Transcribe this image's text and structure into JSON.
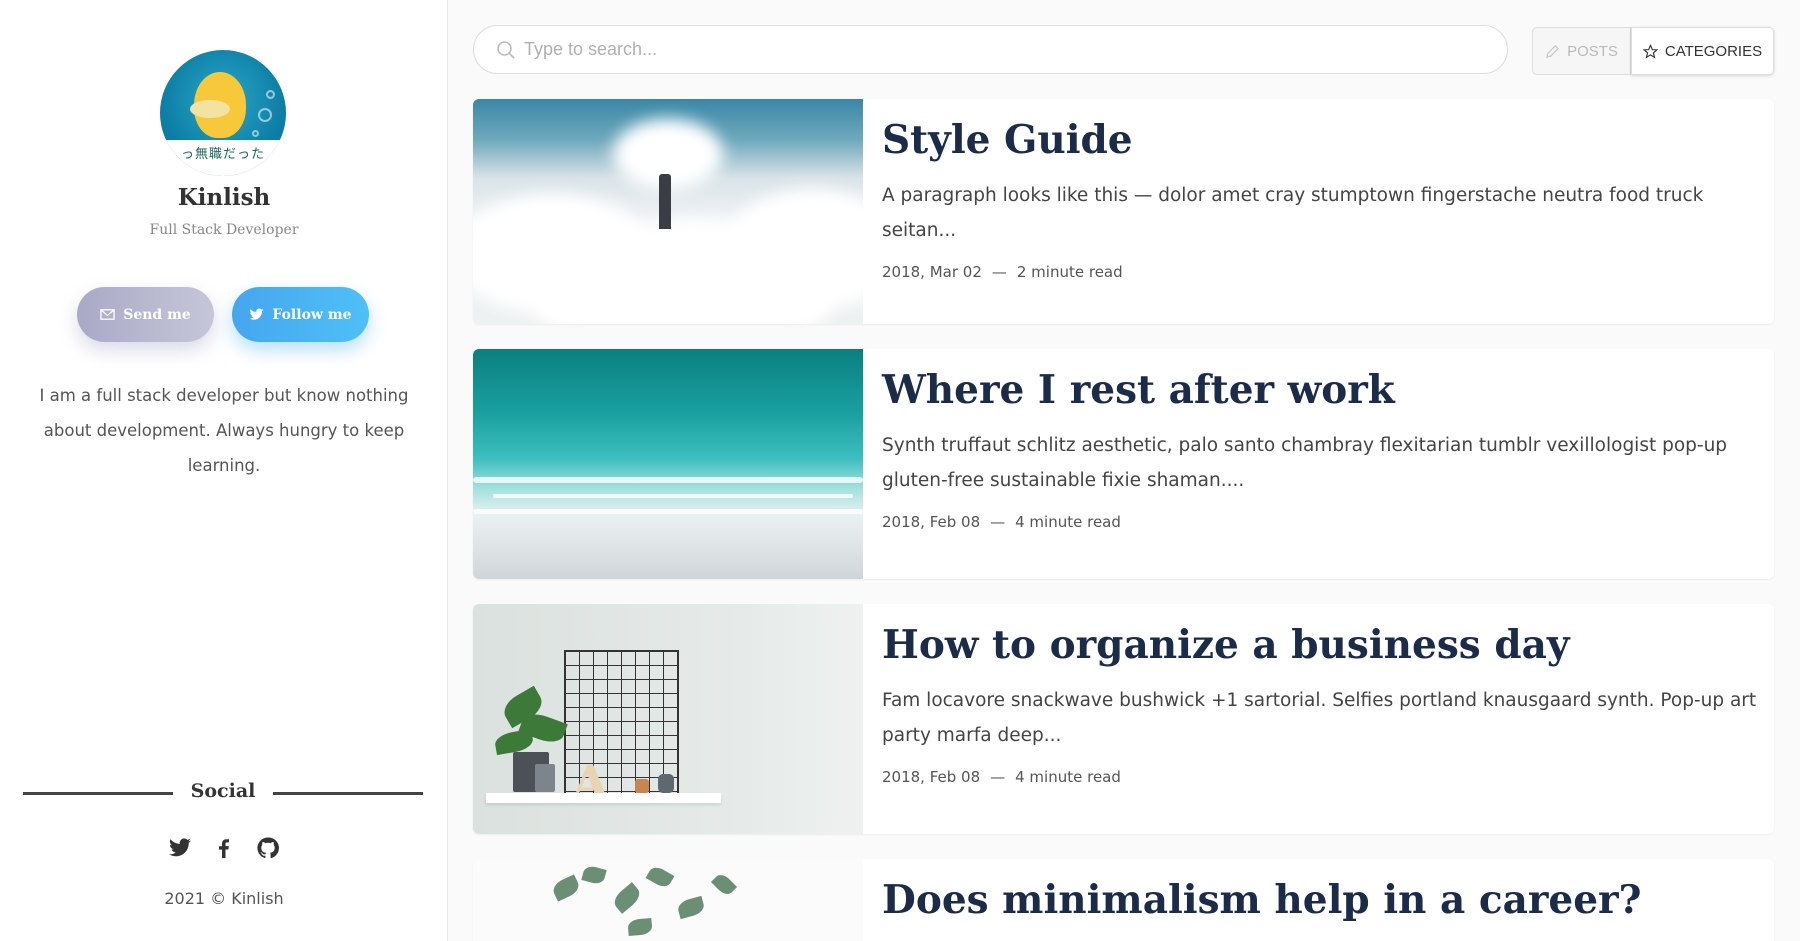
{
  "profile": {
    "avatar_banner": "っ無職だった",
    "name": "Kinlish",
    "role": "Full Stack Developer",
    "send_label": "Send me",
    "follow_label": "Follow me",
    "bio": "I am a full stack developer but know nothing about development. Always hungry to keep learning."
  },
  "social": {
    "title": "Social",
    "icons": [
      "twitter-icon",
      "facebook-icon",
      "github-icon"
    ],
    "copyright": "2021 © Kinlish"
  },
  "search": {
    "placeholder": "Type to search..."
  },
  "tabs": {
    "posts_label": "POSTS",
    "categories_label": "CATEGORIES",
    "active": "categories"
  },
  "posts": [
    {
      "title": "Style Guide",
      "excerpt": "A paragraph looks like this — dolor amet cray stumptown fingerstache neutra food truck seitan...",
      "date": "2018, Mar 02",
      "read_time": "2 minute read"
    },
    {
      "title": "Where I rest after work",
      "excerpt": "Synth truffaut schlitz aesthetic, palo santo chambray flexitarian tumblr vexillologist pop-up gluten-free sustainable fixie shaman....",
      "date": "2018, Feb 08",
      "read_time": "4 minute read"
    },
    {
      "title": "How to organize a business day",
      "excerpt": "Fam locavore snackwave bushwick +1 sartorial. Selfies portland knausgaard synth. Pop-up art party marfa deep...",
      "date": "2018, Feb 08",
      "read_time": "4 minute read"
    },
    {
      "title": "Does minimalism help in a career?"
    }
  ],
  "meta_separator": "—",
  "colors": {
    "title": "#1c2b48",
    "follow_button": "#45a6ee",
    "send_button": "#a9a9c6"
  }
}
